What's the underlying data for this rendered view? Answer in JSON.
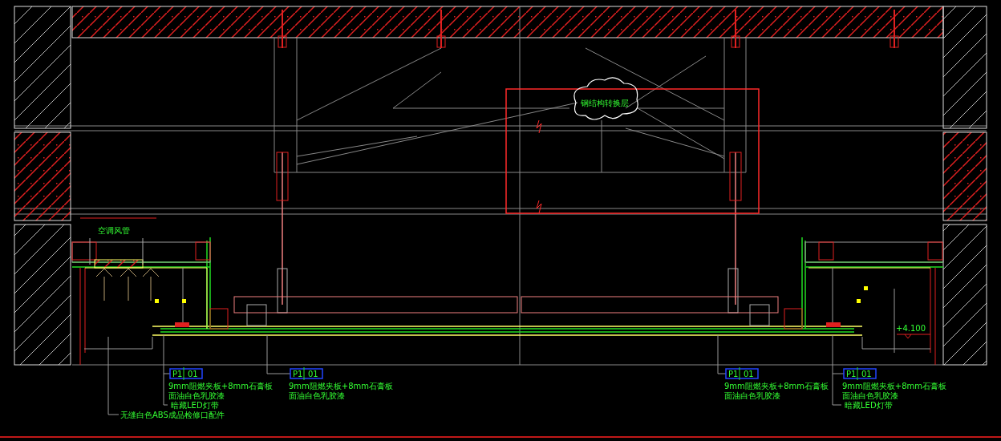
{
  "cloud_note": {
    "text": "钢结构转换层"
  },
  "duct_label": {
    "text": "空调风管"
  },
  "access_panel_note": {
    "text": "无缝白色ABS成品检修口配件"
  },
  "level_mark": {
    "text": "+4.100"
  },
  "material_tags": [
    {
      "code": "P1",
      "number": "01",
      "lines": [
        "9mm阻燃夹板+8mm石膏板",
        "面油白色乳胶漆"
      ],
      "led_note": "暗藏LED灯带"
    },
    {
      "code": "P1",
      "number": "01",
      "lines": [
        "9mm阻燃夹板+8mm石膏板",
        "面油白色乳胶漆"
      ]
    },
    {
      "code": "P1",
      "number": "01",
      "lines": [
        "9mm阻燃夹板+8mm石膏板",
        "面油白色乳胶漆"
      ]
    },
    {
      "code": "P1",
      "number": "01",
      "lines": [
        "9mm阻燃夹板+8mm石膏板",
        "面油白色乳胶漆"
      ],
      "led_note": "暗藏LED灯带"
    }
  ]
}
